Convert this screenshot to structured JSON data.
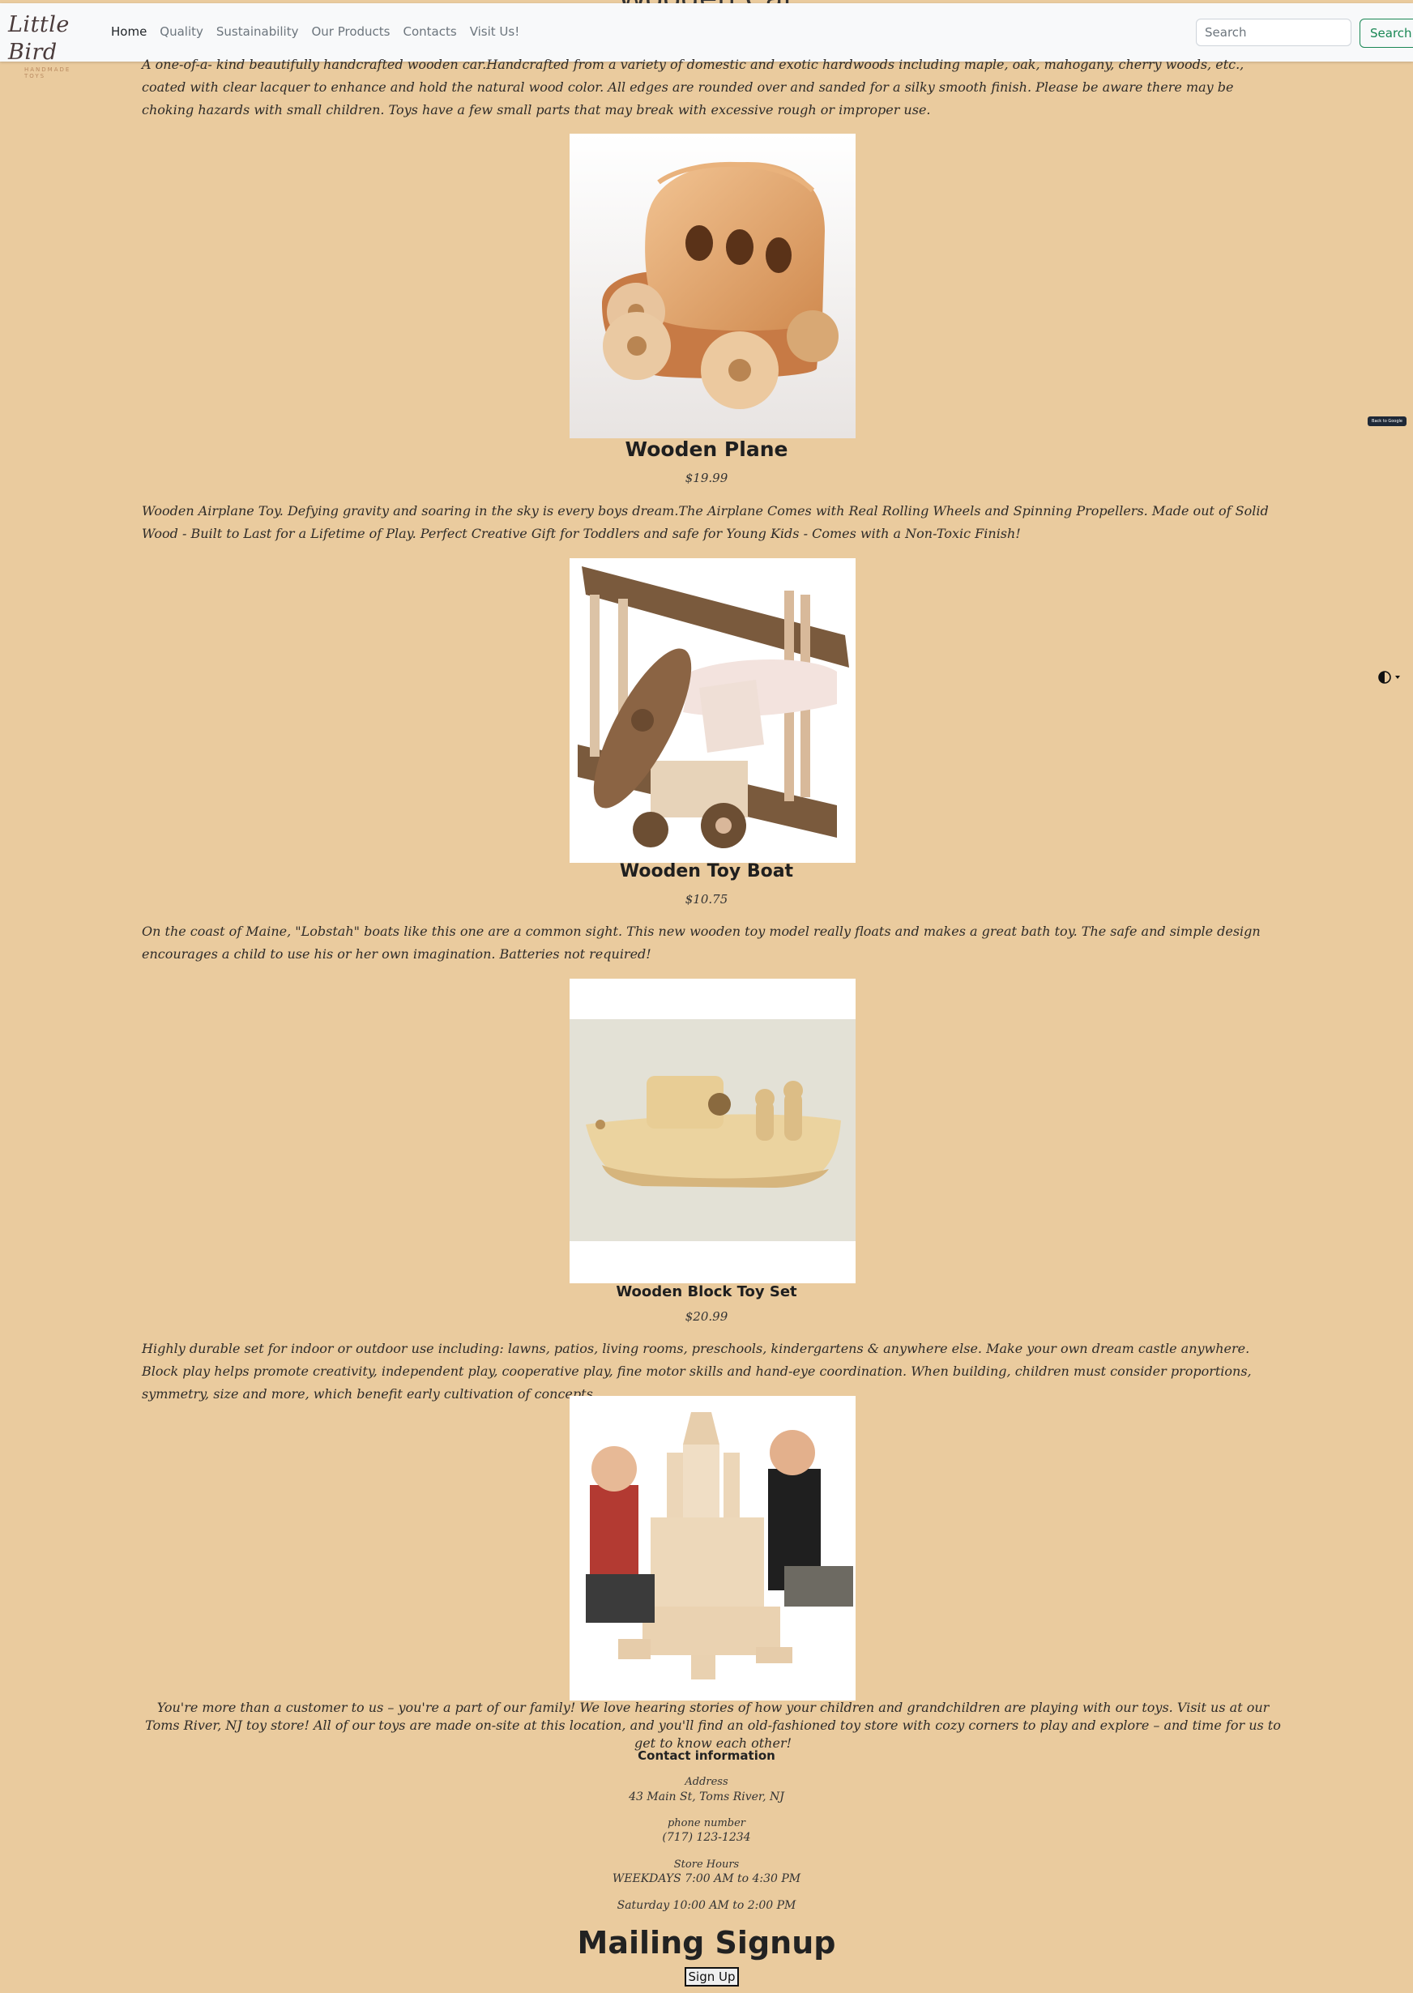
{
  "page_title_behind": "Wooden Car",
  "navbar": {
    "logo": {
      "word": "Little Bird",
      "sub": "HANDMADE TOYS"
    },
    "items": [
      {
        "label": "Home"
      },
      {
        "label": "Quality"
      },
      {
        "label": "Sustainability"
      },
      {
        "label": "Our Products"
      },
      {
        "label": "Contacts"
      },
      {
        "label": "Visit Us!"
      }
    ],
    "search": {
      "placeholder": "Search",
      "button_label": "Search"
    }
  },
  "products": [
    {
      "title": "Wooden Car",
      "description": "A one-of-a- kind beautifully handcrafted wooden car.Handcrafted from a variety of domestic and exotic hardwoods including maple, oak, mahogany, cherry woods, etc., coated with clear lacquer to enhance and hold the natural wood color. All edges are rounded over and sanded for a silky smooth finish. Please be aware there may be choking hazards with small children. Toys have a few small parts that may break with excessive rough or improper use."
    },
    {
      "title": "Wooden Plane",
      "price": "$19.99",
      "description": "Wooden Airplane Toy. Defying gravity and soaring in the sky is every boys dream.The Airplane Comes with Real Rolling Wheels and Spinning Propellers. Made out of Solid Wood - Built to Last for a Lifetime of Play. Perfect Creative Gift for Toddlers and safe for Young Kids - Comes with a Non-Toxic Finish!"
    },
    {
      "title": "Wooden Toy Boat",
      "price": "$10.75",
      "description": "On the coast of Maine, \"Lobstah\" boats like this one are a common sight. This new wooden toy model really floats and makes a great bath toy. The safe and simple design encourages a child to use his or her own imagination. Batteries not required!"
    },
    {
      "title": "Wooden Block Toy Set",
      "price": "$20.99",
      "description": "Highly durable set for indoor or outdoor use including: lawns, patios, living rooms, preschools, kindergartens & anywhere else. Make your own dream castle anywhere. Block play helps promote creativity, independent play, cooperative play, fine motor skills and hand-eye coordination. When building, children must consider proportions, symmetry, size and more, which benefit early cultivation of concepts."
    }
  ],
  "visit": {
    "text": "You're more than a customer to us – you're a part of our family! We love hearing stories of how your children and grandchildren are playing with our toys. Visit us at our Toms River, NJ toy store! All of our toys are made on-site at this location, and you'll find an old-fashioned toy store with cozy corners to play and explore – and time for us to get to know each other!"
  },
  "contact": {
    "heading": "Contact information",
    "address_label": "Address",
    "address": "43 Main St, Toms River, NJ",
    "phone_label": "phone number",
    "phone": "(717) 123-1234",
    "hours_label": "Store Hours",
    "weekdays": "WEEKDAYS 7:00 AM to 4:30 PM",
    "saturday": "Saturday 10:00 AM to 2:00 PM"
  },
  "mailing": {
    "title": "Mailing Signup",
    "button_label": "Sign Up"
  },
  "badge": {
    "text": "Back to Google"
  },
  "theme_toggle": {
    "icon": "half-circle-icon"
  },
  "colors": {
    "background": "#eacb9e",
    "navbar": "#f8f9fa",
    "search_button": "#198754"
  }
}
